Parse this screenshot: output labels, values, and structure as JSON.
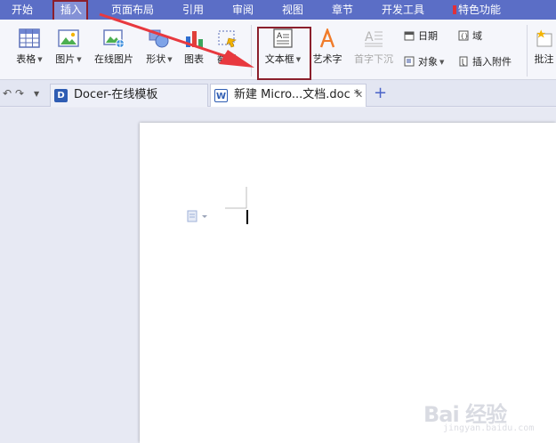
{
  "menubar": {
    "items": [
      "开始",
      "插入",
      "页面布局",
      "引用",
      "审阅",
      "视图",
      "章节",
      "开发工具",
      "特色功能"
    ],
    "active": "插入"
  },
  "ribbon": {
    "table": "表格",
    "picture": "图片",
    "online_picture": "在线图片",
    "shapes": "形状",
    "chart": "图表",
    "screenshot": "截屏",
    "textbox": "文本框",
    "wordart": "艺术字",
    "drop_cap": "首字下沉",
    "date": "日期",
    "object": "对象",
    "field": "域",
    "insert_attachment": "插入附件",
    "comment": "批注"
  },
  "tabs": [
    {
      "label": "Docer-在线模板",
      "icon": "docer-icon"
    },
    {
      "label": "新建 Micro...文档.doc *",
      "icon": "word-doc-icon"
    }
  ],
  "watermark": {
    "text": "Bai 经验",
    "sub": "jingyan.baidu.com"
  },
  "colors": {
    "menubar": "#5b6ec6",
    "highlight_box": "#8b1f2c",
    "arrow": "#e8393f",
    "wordart_icon": "#f07b2a",
    "tab_accent": "#2f5db3"
  }
}
